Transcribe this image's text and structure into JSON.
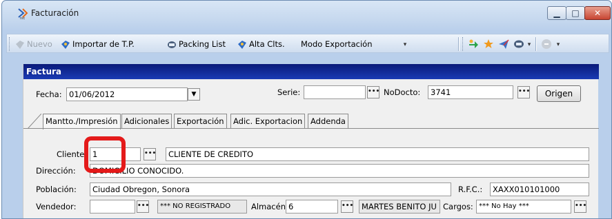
{
  "window": {
    "title": "Facturación",
    "app_icon": "invoice-app-icon",
    "controls": {
      "minimize": "▁",
      "maximize": "□",
      "close": "✕"
    }
  },
  "toolbar": {
    "nuevo": "Nuevo",
    "importar": "Importar de T.P.",
    "packing": "Packing List",
    "alta": "Alta Clts.",
    "modo": "Modo Exportación"
  },
  "factura": {
    "header": "Factura",
    "fecha_label": "Fecha:",
    "fecha_value": "01/06/2012",
    "serie_label": "Serie:",
    "serie_value": "",
    "nodocto_label": "NoDocto:",
    "nodocto_value": "3741",
    "origen_label": "Origen"
  },
  "tabs": [
    "Mantto./Impresión",
    "Adicionales",
    "Exportación",
    "Adic. Exportacion",
    "Addenda"
  ],
  "form": {
    "cliente_label": "Cliente",
    "cliente_value": "1",
    "cliente_name": "CLIENTE DE CREDITO",
    "direccion_label": "Dirección:",
    "direccion_value": "DOMICILIO CONOCIDO.",
    "poblacion_label": "Población:",
    "poblacion_value": "Ciudad Obregon, Sonora",
    "rfc_label": "R.F.C.:",
    "rfc_value": "XAXX010101000",
    "vendedor_label": "Vendedor:",
    "vendedor_value": "",
    "vendedor_name": "*** NO REGISTRADO",
    "almacen_label": "Almacén:",
    "almacen_value": "6",
    "almacen_name": "MARTES BENITO JU",
    "cargos_label": "Cargos:",
    "cargos_value": "*** No Hay ***"
  },
  "colors": {
    "header_bg": "#1a3bb4",
    "highlight": "#e41a1a"
  }
}
